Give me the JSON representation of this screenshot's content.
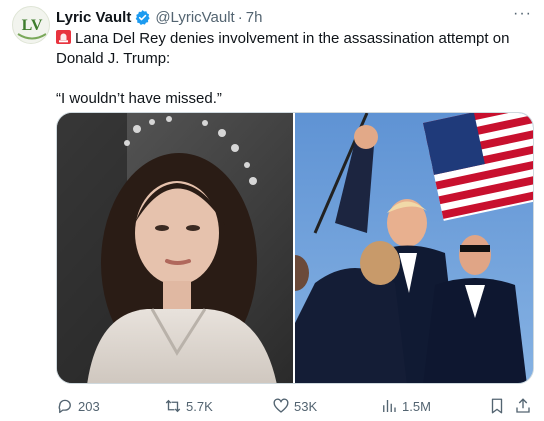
{
  "tweet": {
    "author_name": "Lyric Vault",
    "avatar_text": "LV",
    "handle": "@LyricVault",
    "separator": "·",
    "time": "7h",
    "more_label": "···",
    "verified": true,
    "text_line1": "Lana Del Rey denies involvement in the assassination attempt on Donald J. Trump:",
    "text_line2": "“I wouldn’t have missed.”"
  },
  "media": {
    "left_image": "portrait-photo",
    "right_image": "rally-photo"
  },
  "actions": {
    "replies": "203",
    "reposts": "5.7K",
    "likes": "53K",
    "views": "1.5M"
  },
  "colors": {
    "verified_blue": "#1d9bf0",
    "muted_text": "#536471",
    "avatar_green": "#3f7d2e",
    "siren_red": "#e8343f"
  }
}
